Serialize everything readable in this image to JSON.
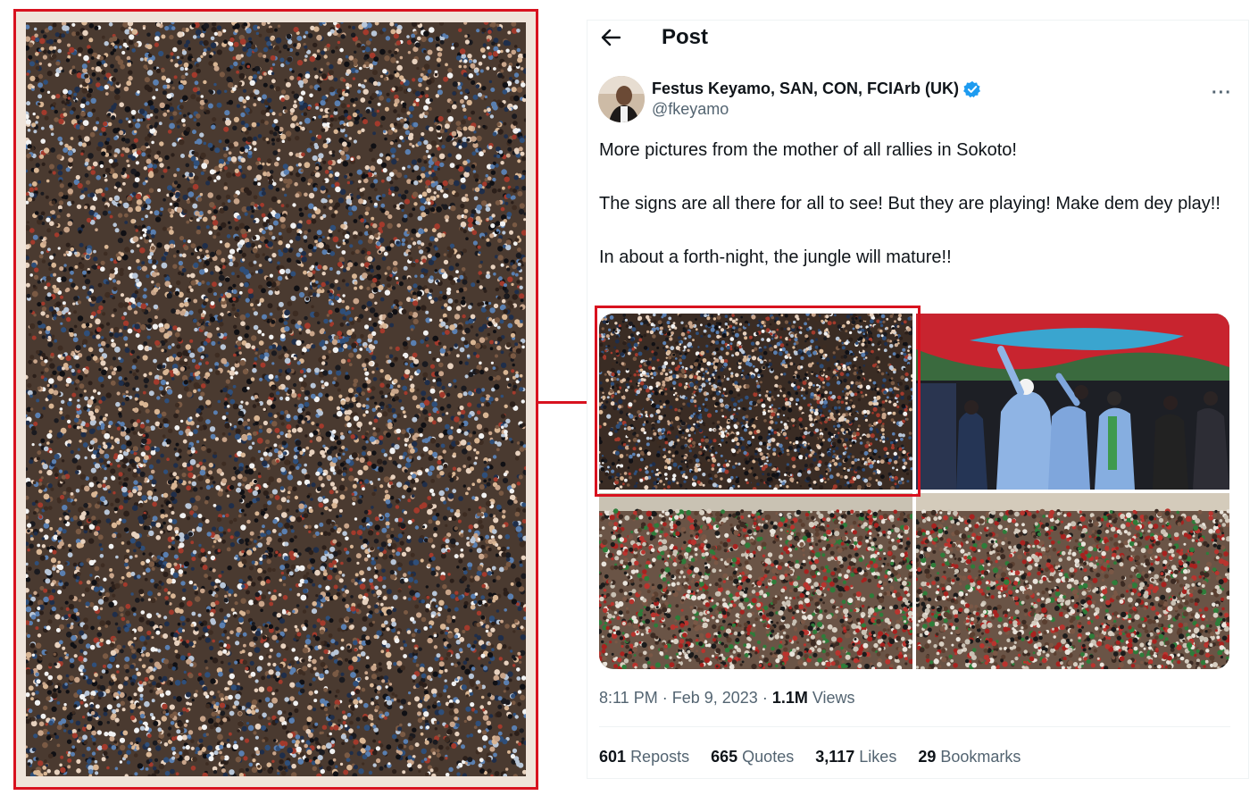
{
  "header": {
    "title": "Post"
  },
  "author": {
    "display_name": "Festus Keyamo, SAN, CON, FCIArb (UK)",
    "handle": "@fkeyamo"
  },
  "post": {
    "paragraphs": [
      "More pictures from the mother of all rallies in Sokoto!",
      "The signs are all there for all to see! But they are playing! Make dem dey play!!",
      "In about a forth-night, the jungle will mature!!"
    ],
    "time": "8:11 PM",
    "date": "Feb 9, 2023",
    "views_count": "1.1M",
    "views_label": "Views"
  },
  "stats": [
    {
      "count": "601",
      "label": "Reposts"
    },
    {
      "count": "665",
      "label": "Quotes"
    },
    {
      "count": "3,117",
      "label": "Likes"
    },
    {
      "count": "29",
      "label": "Bookmarks"
    }
  ],
  "colors": {
    "highlight": "#d8121f",
    "verified": "#1d9bf0",
    "text_primary": "#0f1419",
    "text_secondary": "#536471"
  },
  "icons": {
    "back": "arrow-left-icon",
    "verified": "verified-badge-icon",
    "more": "more-horizontal-icon"
  }
}
